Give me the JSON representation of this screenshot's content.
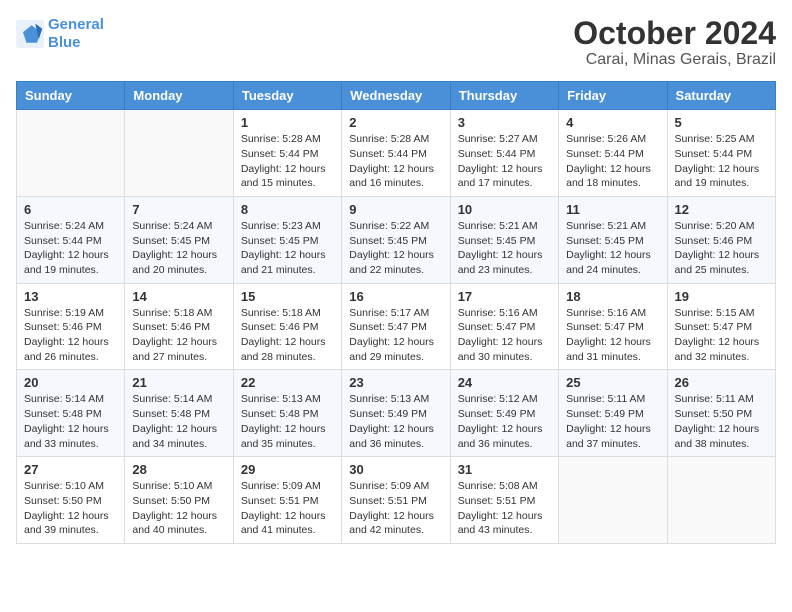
{
  "header": {
    "logo_line1": "General",
    "logo_line2": "Blue",
    "title": "October 2024",
    "subtitle": "Carai, Minas Gerais, Brazil"
  },
  "weekdays": [
    "Sunday",
    "Monday",
    "Tuesday",
    "Wednesday",
    "Thursday",
    "Friday",
    "Saturday"
  ],
  "weeks": [
    [
      {
        "day": null,
        "sunrise": null,
        "sunset": null,
        "daylight": null
      },
      {
        "day": null,
        "sunrise": null,
        "sunset": null,
        "daylight": null
      },
      {
        "day": "1",
        "sunrise": "Sunrise: 5:28 AM",
        "sunset": "Sunset: 5:44 PM",
        "daylight": "Daylight: 12 hours and 15 minutes."
      },
      {
        "day": "2",
        "sunrise": "Sunrise: 5:28 AM",
        "sunset": "Sunset: 5:44 PM",
        "daylight": "Daylight: 12 hours and 16 minutes."
      },
      {
        "day": "3",
        "sunrise": "Sunrise: 5:27 AM",
        "sunset": "Sunset: 5:44 PM",
        "daylight": "Daylight: 12 hours and 17 minutes."
      },
      {
        "day": "4",
        "sunrise": "Sunrise: 5:26 AM",
        "sunset": "Sunset: 5:44 PM",
        "daylight": "Daylight: 12 hours and 18 minutes."
      },
      {
        "day": "5",
        "sunrise": "Sunrise: 5:25 AM",
        "sunset": "Sunset: 5:44 PM",
        "daylight": "Daylight: 12 hours and 19 minutes."
      }
    ],
    [
      {
        "day": "6",
        "sunrise": "Sunrise: 5:24 AM",
        "sunset": "Sunset: 5:44 PM",
        "daylight": "Daylight: 12 hours and 19 minutes."
      },
      {
        "day": "7",
        "sunrise": "Sunrise: 5:24 AM",
        "sunset": "Sunset: 5:45 PM",
        "daylight": "Daylight: 12 hours and 20 minutes."
      },
      {
        "day": "8",
        "sunrise": "Sunrise: 5:23 AM",
        "sunset": "Sunset: 5:45 PM",
        "daylight": "Daylight: 12 hours and 21 minutes."
      },
      {
        "day": "9",
        "sunrise": "Sunrise: 5:22 AM",
        "sunset": "Sunset: 5:45 PM",
        "daylight": "Daylight: 12 hours and 22 minutes."
      },
      {
        "day": "10",
        "sunrise": "Sunrise: 5:21 AM",
        "sunset": "Sunset: 5:45 PM",
        "daylight": "Daylight: 12 hours and 23 minutes."
      },
      {
        "day": "11",
        "sunrise": "Sunrise: 5:21 AM",
        "sunset": "Sunset: 5:45 PM",
        "daylight": "Daylight: 12 hours and 24 minutes."
      },
      {
        "day": "12",
        "sunrise": "Sunrise: 5:20 AM",
        "sunset": "Sunset: 5:46 PM",
        "daylight": "Daylight: 12 hours and 25 minutes."
      }
    ],
    [
      {
        "day": "13",
        "sunrise": "Sunrise: 5:19 AM",
        "sunset": "Sunset: 5:46 PM",
        "daylight": "Daylight: 12 hours and 26 minutes."
      },
      {
        "day": "14",
        "sunrise": "Sunrise: 5:18 AM",
        "sunset": "Sunset: 5:46 PM",
        "daylight": "Daylight: 12 hours and 27 minutes."
      },
      {
        "day": "15",
        "sunrise": "Sunrise: 5:18 AM",
        "sunset": "Sunset: 5:46 PM",
        "daylight": "Daylight: 12 hours and 28 minutes."
      },
      {
        "day": "16",
        "sunrise": "Sunrise: 5:17 AM",
        "sunset": "Sunset: 5:47 PM",
        "daylight": "Daylight: 12 hours and 29 minutes."
      },
      {
        "day": "17",
        "sunrise": "Sunrise: 5:16 AM",
        "sunset": "Sunset: 5:47 PM",
        "daylight": "Daylight: 12 hours and 30 minutes."
      },
      {
        "day": "18",
        "sunrise": "Sunrise: 5:16 AM",
        "sunset": "Sunset: 5:47 PM",
        "daylight": "Daylight: 12 hours and 31 minutes."
      },
      {
        "day": "19",
        "sunrise": "Sunrise: 5:15 AM",
        "sunset": "Sunset: 5:47 PM",
        "daylight": "Daylight: 12 hours and 32 minutes."
      }
    ],
    [
      {
        "day": "20",
        "sunrise": "Sunrise: 5:14 AM",
        "sunset": "Sunset: 5:48 PM",
        "daylight": "Daylight: 12 hours and 33 minutes."
      },
      {
        "day": "21",
        "sunrise": "Sunrise: 5:14 AM",
        "sunset": "Sunset: 5:48 PM",
        "daylight": "Daylight: 12 hours and 34 minutes."
      },
      {
        "day": "22",
        "sunrise": "Sunrise: 5:13 AM",
        "sunset": "Sunset: 5:48 PM",
        "daylight": "Daylight: 12 hours and 35 minutes."
      },
      {
        "day": "23",
        "sunrise": "Sunrise: 5:13 AM",
        "sunset": "Sunset: 5:49 PM",
        "daylight": "Daylight: 12 hours and 36 minutes."
      },
      {
        "day": "24",
        "sunrise": "Sunrise: 5:12 AM",
        "sunset": "Sunset: 5:49 PM",
        "daylight": "Daylight: 12 hours and 36 minutes."
      },
      {
        "day": "25",
        "sunrise": "Sunrise: 5:11 AM",
        "sunset": "Sunset: 5:49 PM",
        "daylight": "Daylight: 12 hours and 37 minutes."
      },
      {
        "day": "26",
        "sunrise": "Sunrise: 5:11 AM",
        "sunset": "Sunset: 5:50 PM",
        "daylight": "Daylight: 12 hours and 38 minutes."
      }
    ],
    [
      {
        "day": "27",
        "sunrise": "Sunrise: 5:10 AM",
        "sunset": "Sunset: 5:50 PM",
        "daylight": "Daylight: 12 hours and 39 minutes."
      },
      {
        "day": "28",
        "sunrise": "Sunrise: 5:10 AM",
        "sunset": "Sunset: 5:50 PM",
        "daylight": "Daylight: 12 hours and 40 minutes."
      },
      {
        "day": "29",
        "sunrise": "Sunrise: 5:09 AM",
        "sunset": "Sunset: 5:51 PM",
        "daylight": "Daylight: 12 hours and 41 minutes."
      },
      {
        "day": "30",
        "sunrise": "Sunrise: 5:09 AM",
        "sunset": "Sunset: 5:51 PM",
        "daylight": "Daylight: 12 hours and 42 minutes."
      },
      {
        "day": "31",
        "sunrise": "Sunrise: 5:08 AM",
        "sunset": "Sunset: 5:51 PM",
        "daylight": "Daylight: 12 hours and 43 minutes."
      },
      {
        "day": null,
        "sunrise": null,
        "sunset": null,
        "daylight": null
      },
      {
        "day": null,
        "sunrise": null,
        "sunset": null,
        "daylight": null
      }
    ]
  ]
}
